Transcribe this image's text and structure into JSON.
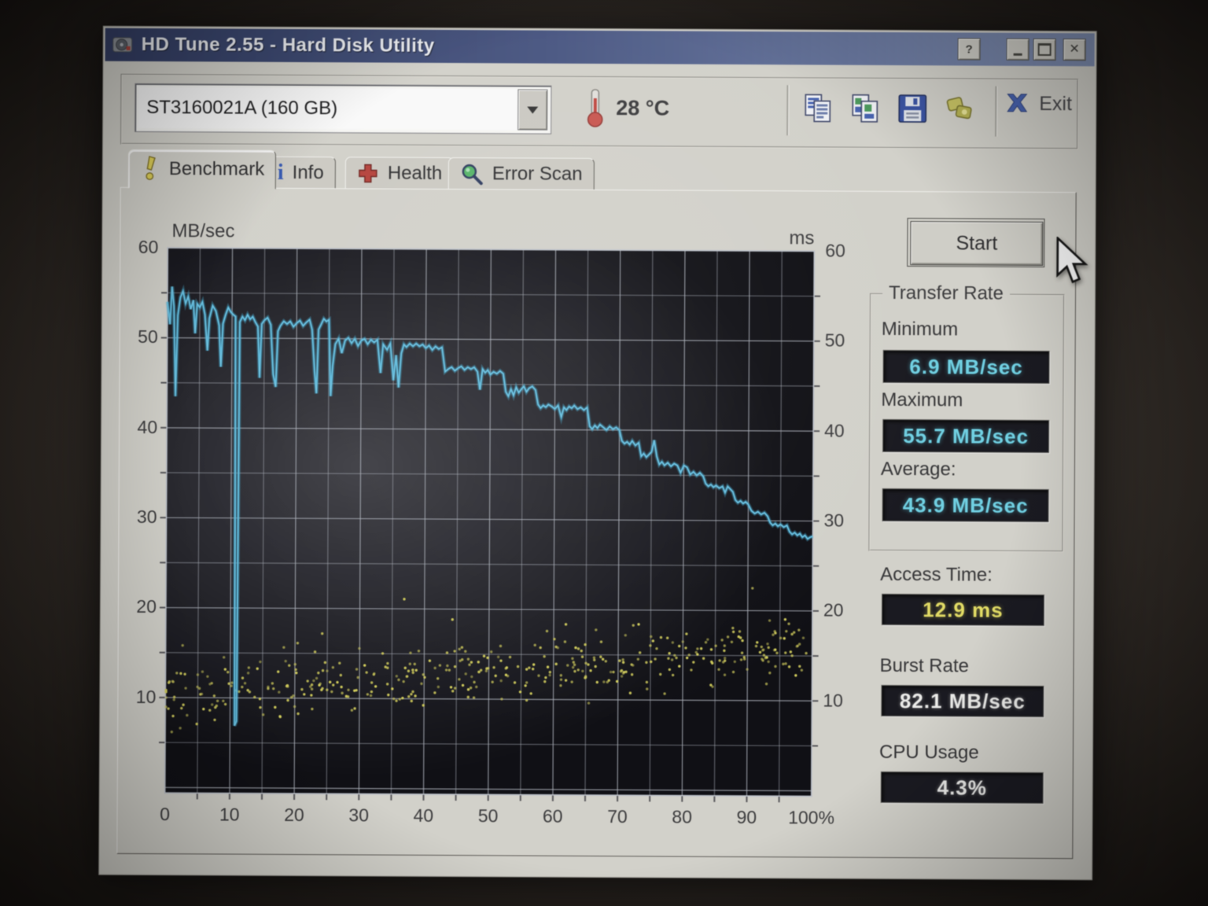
{
  "window": {
    "title": "HD Tune 2.55 - Hard Disk Utility"
  },
  "toolbar": {
    "drive_selector": {
      "value": "ST3160021A (160 GB)"
    },
    "temperature": "28 °C",
    "exit_label": "Exit",
    "icons": [
      "copy-text-icon",
      "copy-image-icon",
      "save-icon",
      "capture-icon"
    ]
  },
  "tabs": [
    {
      "label": "Benchmark",
      "icon": "bolt-icon",
      "active": true
    },
    {
      "label": "Info",
      "icon": "info-icon",
      "active": false
    },
    {
      "label": "Health",
      "icon": "health-cross-icon",
      "active": false
    },
    {
      "label": "Error Scan",
      "icon": "magnifier-icon",
      "active": false
    }
  ],
  "side": {
    "start_label": "Start",
    "transfer_rate": {
      "title": "Transfer Rate",
      "minimum_label": "Minimum",
      "minimum": "6.9 MB/sec",
      "maximum_label": "Maximum",
      "maximum": "55.7 MB/sec",
      "average_label": "Average:",
      "average": "43.9 MB/sec"
    },
    "access_time_label": "Access Time:",
    "access_time": "12.9 ms",
    "burst_rate_label": "Burst Rate",
    "burst_rate": "82.1 MB/sec",
    "cpu_usage_label": "CPU Usage",
    "cpu_usage": "4.3%"
  },
  "chart_data": {
    "type": "line+scatter",
    "left_axis": {
      "label": "MB/sec",
      "ticks": [
        60,
        50,
        40,
        30,
        20,
        10
      ],
      "max": 60,
      "min": -0.6
    },
    "right_axis": {
      "label": "ms",
      "ticks": [
        60,
        50,
        40,
        30,
        20,
        10
      ]
    },
    "x_axis": {
      "ticks": [
        "0",
        "10",
        "20",
        "30",
        "40",
        "50",
        "60",
        "70",
        "80",
        "90",
        "100%"
      ],
      "max_percent": 100
    },
    "grid": {
      "x_step_percent": 5,
      "y_step_units": 5,
      "on": true
    },
    "transfer_series": {
      "name": "transfer-rate-line",
      "color": "#36b6e6",
      "points": [
        [
          0,
          54
        ],
        [
          0.4,
          51.5
        ],
        [
          0.7,
          55.7
        ],
        [
          1,
          53.5
        ],
        [
          1.3,
          43.5
        ],
        [
          1.6,
          52.5
        ],
        [
          2,
          54.5
        ],
        [
          2.4,
          55.2
        ],
        [
          2.8,
          53.8
        ],
        [
          3.2,
          54.6
        ],
        [
          3.6,
          53.2
        ],
        [
          4,
          54.2
        ],
        [
          4.3,
          50.5
        ],
        [
          4.6,
          53.8
        ],
        [
          5,
          53.4
        ],
        [
          5.4,
          54
        ],
        [
          5.8,
          52.6
        ],
        [
          6.2,
          48.6
        ],
        [
          6.5,
          52.2
        ],
        [
          7,
          53.6
        ],
        [
          7.5,
          53
        ],
        [
          8,
          51.4
        ],
        [
          8.3,
          46.8
        ],
        [
          8.6,
          51.6
        ],
        [
          9,
          52.6
        ],
        [
          9.4,
          53.4
        ],
        [
          9.8,
          52.9
        ],
        [
          10.2,
          52.6
        ],
        [
          10.55,
          52.4
        ],
        [
          10.7,
          6.9
        ],
        [
          11,
          7.4
        ],
        [
          11.2,
          51.8
        ],
        [
          11.6,
          52.4
        ],
        [
          12,
          52
        ],
        [
          12.4,
          52.6
        ],
        [
          12.8,
          52.1
        ],
        [
          13.2,
          52.4
        ],
        [
          13.6,
          51.8
        ],
        [
          14,
          51.3
        ],
        [
          14.3,
          45.6
        ],
        [
          14.6,
          51.6
        ],
        [
          15,
          52
        ],
        [
          15.5,
          52.3
        ],
        [
          16,
          51.5
        ],
        [
          16.4,
          46
        ],
        [
          16.8,
          44.6
        ],
        [
          17.1,
          50.8
        ],
        [
          17.5,
          51.4
        ],
        [
          18,
          51.9
        ],
        [
          18.5,
          51.6
        ],
        [
          19,
          51.9
        ],
        [
          19.5,
          51.3
        ],
        [
          20,
          51.7
        ],
        [
          20.5,
          52
        ],
        [
          21,
          51.4
        ],
        [
          21.5,
          51.8
        ],
        [
          22,
          52.1
        ],
        [
          22.4,
          51
        ],
        [
          22.8,
          46.4
        ],
        [
          23.1,
          43.9
        ],
        [
          23.4,
          51
        ],
        [
          23.8,
          51.6
        ],
        [
          24.2,
          52.2
        ],
        [
          24.6,
          51.9
        ],
        [
          25,
          52.1
        ],
        [
          25.3,
          43.6
        ],
        [
          25.6,
          47
        ],
        [
          26,
          49.4
        ],
        [
          26.5,
          50
        ],
        [
          27,
          48.4
        ],
        [
          27.5,
          49.8
        ],
        [
          28,
          50.1
        ],
        [
          28.5,
          49.5
        ],
        [
          29,
          50
        ],
        [
          29.5,
          49.2
        ],
        [
          30,
          49.8
        ],
        [
          30.5,
          50
        ],
        [
          31,
          49.4
        ],
        [
          31.5,
          49.9
        ],
        [
          32,
          49.6
        ],
        [
          32.5,
          49.9
        ],
        [
          33,
          46.2
        ],
        [
          33.4,
          49.4
        ],
        [
          34,
          48.8
        ],
        [
          34.5,
          49.5
        ],
        [
          35,
          45.4
        ],
        [
          35.4,
          48.2
        ],
        [
          35.8,
          44.6
        ],
        [
          36.2,
          48.4
        ],
        [
          36.6,
          49.4
        ],
        [
          37,
          49.1
        ],
        [
          37.5,
          49.5
        ],
        [
          38,
          49.2
        ],
        [
          38.5,
          49.5
        ],
        [
          39,
          49.2
        ],
        [
          39.5,
          49.4
        ],
        [
          40,
          49
        ],
        [
          40.5,
          49.3
        ],
        [
          41,
          48.8
        ],
        [
          41.5,
          49.2
        ],
        [
          42,
          48.9
        ],
        [
          42.5,
          49.1
        ],
        [
          43,
          46.4
        ],
        [
          43.5,
          46.7
        ],
        [
          44,
          46.9
        ],
        [
          44.5,
          46.5
        ],
        [
          45,
          46.8
        ],
        [
          45.5,
          47
        ],
        [
          46,
          46.6
        ],
        [
          46.5,
          46.9
        ],
        [
          47,
          46.7
        ],
        [
          47.5,
          46.9
        ],
        [
          48,
          46.4
        ],
        [
          48.4,
          44.4
        ],
        [
          48.8,
          46.7
        ],
        [
          49.2,
          46.3
        ],
        [
          49.6,
          46.6
        ],
        [
          50,
          46.1
        ],
        [
          50.5,
          46.4
        ],
        [
          51,
          46.2
        ],
        [
          51.5,
          46.5
        ],
        [
          52,
          46.2
        ],
        [
          52.4,
          44.2
        ],
        [
          52.8,
          43.7
        ],
        [
          53.2,
          44.5
        ],
        [
          53.6,
          43.8
        ],
        [
          54,
          44.7
        ],
        [
          54.4,
          44.1
        ],
        [
          54.8,
          44.5
        ],
        [
          55.2,
          44.8
        ],
        [
          55.6,
          44.2
        ],
        [
          56,
          44.6
        ],
        [
          56.5,
          44.8
        ],
        [
          57,
          44.4
        ],
        [
          57.4,
          42.8
        ],
        [
          57.8,
          42.4
        ],
        [
          58.2,
          42.7
        ],
        [
          58.6,
          42.5
        ],
        [
          59,
          42.8
        ],
        [
          59.5,
          42.6
        ],
        [
          60,
          42.3
        ],
        [
          60.5,
          42.7
        ],
        [
          61,
          41.4
        ],
        [
          61.4,
          42.5
        ],
        [
          61.8,
          42.2
        ],
        [
          62.2,
          42.6
        ],
        [
          62.6,
          42.4
        ],
        [
          63,
          42.7
        ],
        [
          63.5,
          42.3
        ],
        [
          64,
          42.5
        ],
        [
          64.5,
          42.2
        ],
        [
          65,
          42.5
        ],
        [
          65.4,
          40.4
        ],
        [
          65.8,
          40.1
        ],
        [
          66.2,
          40.5
        ],
        [
          66.6,
          40.2
        ],
        [
          67,
          40.6
        ],
        [
          67.5,
          40.3
        ],
        [
          68,
          40
        ],
        [
          68.5,
          40.4
        ],
        [
          69,
          40.1
        ],
        [
          69.5,
          40.3
        ],
        [
          70,
          40
        ],
        [
          70.4,
          38.8
        ],
        [
          70.8,
          38.5
        ],
        [
          71.2,
          38.7
        ],
        [
          71.6,
          38.4
        ],
        [
          72,
          38.8
        ],
        [
          72.5,
          38.3
        ],
        [
          73,
          38.6
        ],
        [
          73.4,
          37.1
        ],
        [
          73.8,
          37.4
        ],
        [
          74.2,
          37
        ],
        [
          74.6,
          37.3
        ],
        [
          75,
          37.6
        ],
        [
          75.4,
          38.9
        ],
        [
          75.8,
          37.1
        ],
        [
          76.2,
          36.2
        ],
        [
          76.6,
          36.5
        ],
        [
          77,
          36.1
        ],
        [
          77.5,
          36.4
        ],
        [
          78,
          36
        ],
        [
          78.5,
          36.3
        ],
        [
          79,
          36.1
        ],
        [
          79.5,
          35.3
        ],
        [
          80,
          36.1
        ],
        [
          80.5,
          35.9
        ],
        [
          81,
          35.1
        ],
        [
          81.5,
          35.4
        ],
        [
          82,
          35
        ],
        [
          82.5,
          35.3
        ],
        [
          83,
          34.9
        ],
        [
          83.4,
          34.1
        ],
        [
          83.8,
          33.8
        ],
        [
          84.2,
          34
        ],
        [
          84.6,
          33.7
        ],
        [
          85,
          33.9
        ],
        [
          85.5,
          33.6
        ],
        [
          86,
          33.8
        ],
        [
          86.4,
          33.1
        ],
        [
          86.8,
          33.8
        ],
        [
          87.2,
          33.5
        ],
        [
          87.6,
          33.2
        ],
        [
          88,
          32.3
        ],
        [
          88.4,
          32
        ],
        [
          88.8,
          32.2
        ],
        [
          89.2,
          31.9
        ],
        [
          89.6,
          32.1
        ],
        [
          90,
          31.8
        ],
        [
          90.5,
          31.1
        ],
        [
          91,
          30.8
        ],
        [
          91.5,
          31
        ],
        [
          92,
          30.7
        ],
        [
          92.5,
          30.9
        ],
        [
          93,
          30.5
        ],
        [
          93.4,
          29.8
        ],
        [
          93.8,
          29.5
        ],
        [
          94.2,
          29.7
        ],
        [
          94.6,
          29.4
        ],
        [
          95,
          29.6
        ],
        [
          95.5,
          29.3
        ],
        [
          96,
          29.5
        ],
        [
          96.4,
          28.8
        ],
        [
          96.8,
          28.5
        ],
        [
          97.2,
          28.7
        ],
        [
          97.6,
          28.4
        ],
        [
          98,
          28.6
        ],
        [
          98.4,
          28.2
        ],
        [
          98.8,
          28.4
        ],
        [
          99.2,
          28
        ],
        [
          99.6,
          28.2
        ],
        [
          100,
          28.3
        ]
      ]
    },
    "access_scatter": {
      "name": "access-time-dots",
      "color": "#d8d242",
      "count": 430,
      "seed": 13,
      "trend_start_ms": 10.2,
      "trend_end_ms": 15.8,
      "jitter_ms": 4.8,
      "y_min_ms": 4.5,
      "y_max_ms": 23.5
    }
  }
}
